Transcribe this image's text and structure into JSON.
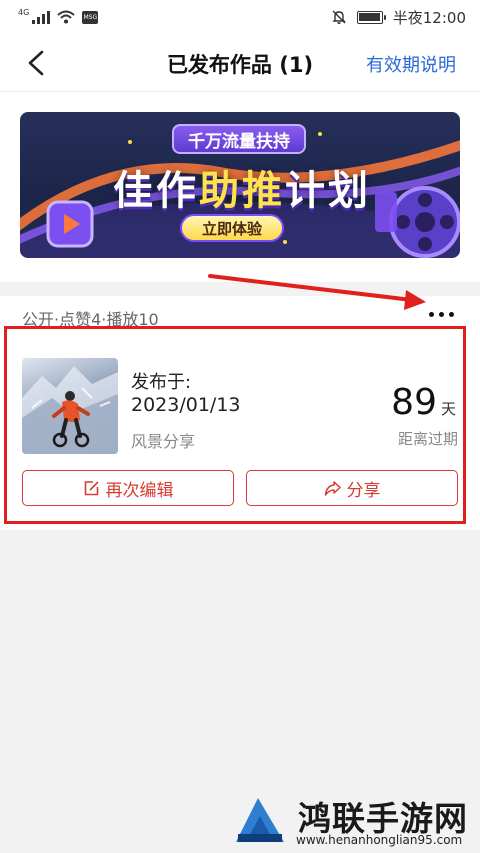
{
  "status_bar": {
    "network": "4G",
    "msg_icon_label": "MSG",
    "time": "半夜12:00",
    "icons": [
      "signal-icon",
      "wifi-icon",
      "message-icon",
      "mute-bell-icon",
      "battery-icon"
    ]
  },
  "nav": {
    "title": "已发布作品 (1)",
    "right_link": "有效期说明",
    "back_icon": "back-arrow-icon"
  },
  "banner": {
    "pill": "千万流量扶持",
    "headline_part1": "佳作",
    "headline_highlight": "助推",
    "headline_part2": "计划",
    "cta": "立即体验"
  },
  "work": {
    "meta": "公开·点赞4·播放10",
    "more_icon": "more-dots-icon",
    "published_label": "发布于:",
    "published_date": "2023/01/13",
    "category": "风景分享",
    "days_left": "89",
    "days_unit": "天",
    "expire_label": "距离过期",
    "edit_button": "再次编辑",
    "share_button": "分享"
  },
  "annotation": {
    "color": "#e0201c"
  },
  "watermark": {
    "title": "鸿联手游网",
    "url": "www.henanhonglian95.com"
  },
  "colors": {
    "accent_blue": "#2a6ad8",
    "button_red": "#d93a32"
  }
}
